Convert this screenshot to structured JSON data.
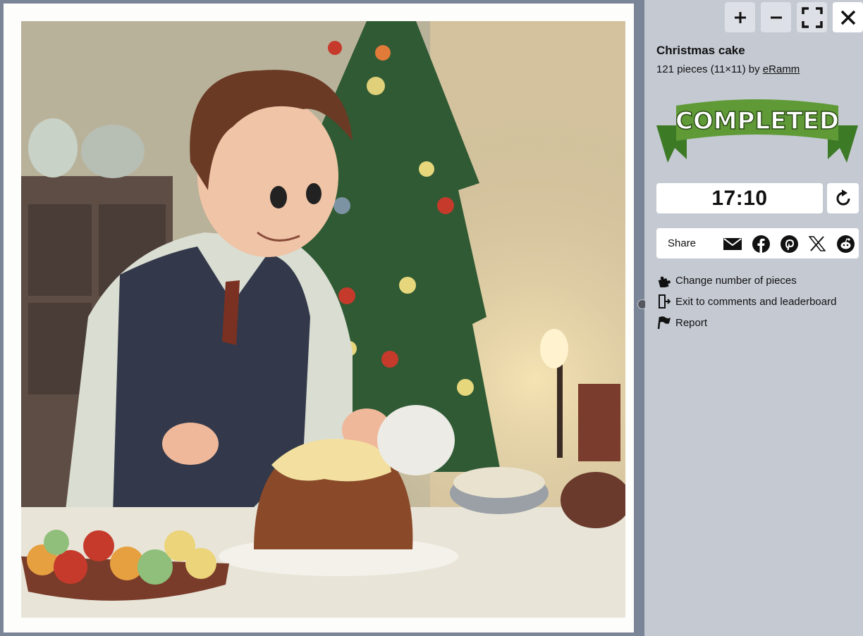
{
  "puzzle": {
    "title": "Christmas cake",
    "pieces_text": "121 pieces (11×11) by ",
    "author": "eRamm"
  },
  "badge": {
    "text": "COMPLETED",
    "color": "#5f9a36"
  },
  "timer": {
    "value": "17:10"
  },
  "share": {
    "label": "Share",
    "icons": [
      "mail-icon",
      "facebook-icon",
      "pinterest-icon",
      "x-icon",
      "reddit-icon"
    ]
  },
  "toolbar": {
    "icons": [
      "zoom-in-icon",
      "zoom-out-icon",
      "fullscreen-icon",
      "close-icon"
    ]
  },
  "menu": {
    "items": [
      {
        "label": "Change number of pieces",
        "icon": "puzzle-piece-icon"
      },
      {
        "label": "Exit to comments and leaderboard",
        "icon": "exit-door-icon"
      },
      {
        "label": "Report",
        "icon": "flag-icon"
      }
    ]
  }
}
